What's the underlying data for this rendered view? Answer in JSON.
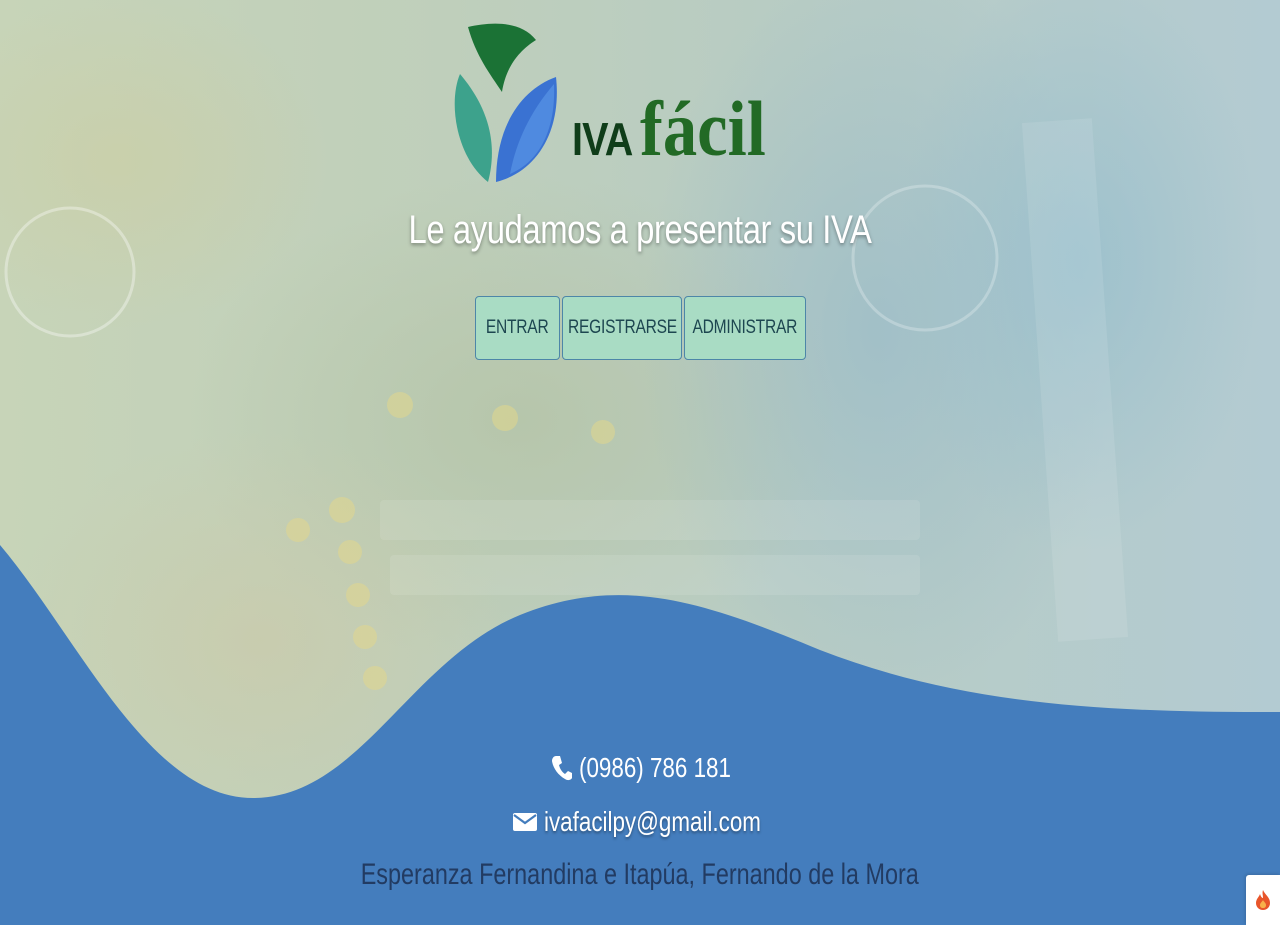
{
  "brand": {
    "name_part1": "IVA",
    "name_part2": "fácil",
    "tagline": "Le ayudamos a presentar su IVA"
  },
  "buttons": {
    "entrar": "ENTRAR",
    "registrarse": "REGISTRARSE",
    "administrar": "ADMINISTRAR"
  },
  "contact": {
    "phone": "(0986) 786 181",
    "email": "ivafacilpy@gmail.com",
    "address": "Esperanza Fernandina e Itapúa, Fernando de la Mora"
  },
  "colors": {
    "wave": "#447dbd",
    "button_bg": "#a9dcc4",
    "logo_dark_green": "#0f3d19",
    "logo_green": "#226a25",
    "address_text": "#223b62"
  },
  "icons": {
    "phone": "phone-icon",
    "email": "envelope-icon",
    "corner": "flame-icon"
  }
}
